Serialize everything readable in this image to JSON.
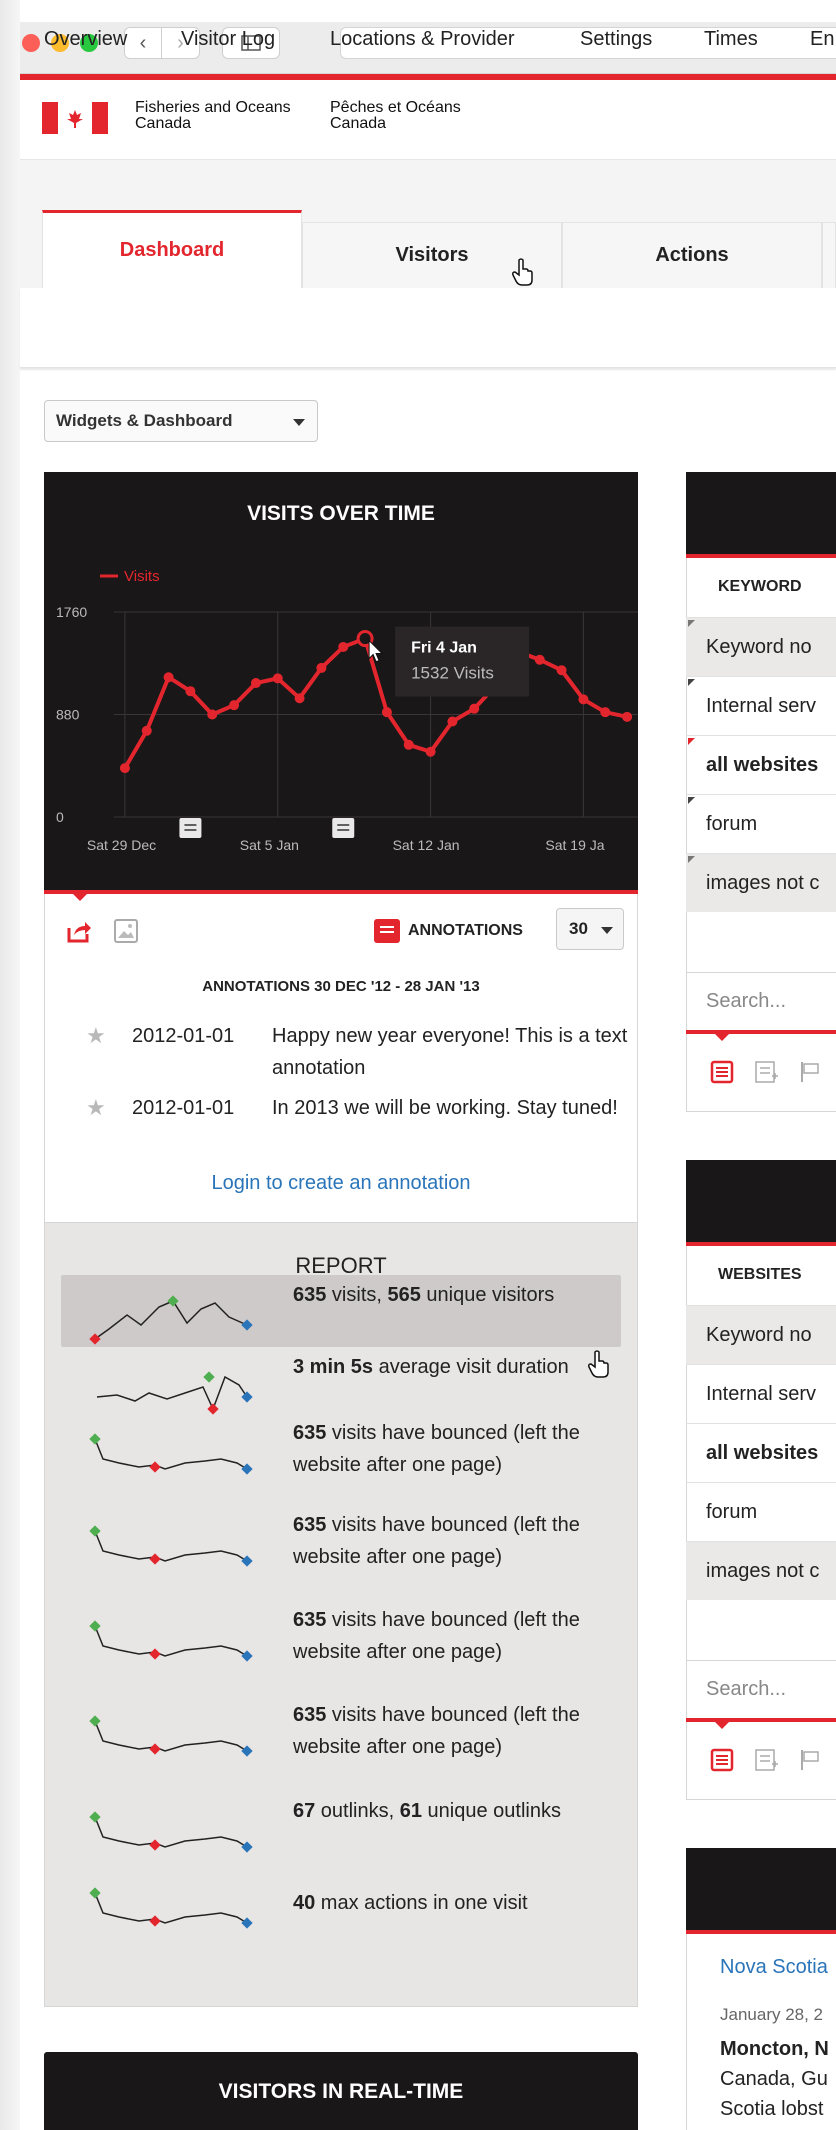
{
  "header": {
    "dept_en": "Fisheries and Oceans Canada",
    "dept_fr": "Pêches et Océans Canada"
  },
  "tabs": [
    {
      "label": "Dashboard",
      "active": true
    },
    {
      "label": "Visitors",
      "active": false
    },
    {
      "label": "Actions",
      "active": false
    }
  ],
  "subnav": [
    "Overview",
    "Visitor Log",
    "Locations & Provider",
    "Settings",
    "Times",
    "En"
  ],
  "widgets_dropdown": "Widgets & Dashboard",
  "visits_chart": {
    "title": "VISITS OVER TIME",
    "tooltip_date": "Fri 4 Jan",
    "tooltip_value": "1532 Visits",
    "annotations_label": "ANNOTATIONS",
    "period_value": "30",
    "chart_data": {
      "type": "line",
      "legend": "Visits",
      "color": "#e3262e",
      "ylim": [
        0,
        1760
      ],
      "y_ticks": [
        "1760",
        "880",
        "0"
      ],
      "x_tick_labels": [
        "Sat 29 Dec",
        "Sat 5 Jan",
        "Sat 12 Jan",
        "Sat 19 Ja"
      ],
      "x": [
        "2012-12-29",
        "2012-12-30",
        "2012-12-31",
        "2013-01-01",
        "2013-01-02",
        "2013-01-03",
        "2013-01-04",
        "2013-01-05",
        "2013-01-06",
        "2013-01-07",
        "2013-01-08",
        "2013-01-09",
        "2013-01-10",
        "2013-01-11",
        "2013-01-12",
        "2013-01-13",
        "2013-01-14",
        "2013-01-15",
        "2013-01-16",
        "2013-01-17",
        "2013-01-18",
        "2013-01-19",
        "2013-01-20",
        "2013-01-21"
      ],
      "values": [
        420,
        740,
        1200,
        1080,
        880,
        960,
        1150,
        1190,
        1020,
        1280,
        1460,
        1532,
        900,
        620,
        560,
        820,
        930,
        1130,
        1420,
        1350,
        1260,
        1010,
        900,
        860
      ],
      "highlight_index": 11
    }
  },
  "annotations": {
    "heading": "ANNOTATIONS 30 DEC '12 - 28 JAN '13",
    "items": [
      {
        "date": "2012-01-01",
        "text": "Happy new year everyone! This is a text annotation"
      },
      {
        "date": "2012-01-01",
        "text": "In 2013 we will be working. Stay tuned!"
      }
    ],
    "login_link": "Login to create an annotation"
  },
  "report": {
    "title": "REPORT",
    "rows": [
      {
        "bold1": "635",
        "t1": " visits, ",
        "bold2": "565",
        "t2": " unique visitors"
      },
      {
        "bold1": "3 min 5s",
        "t1": " average visit duration",
        "bold2": "",
        "t2": ""
      },
      {
        "bold1": "635",
        "t1": " visits have bounced (left the website after one page)",
        "bold2": "",
        "t2": ""
      },
      {
        "bold1": "635",
        "t1": " visits have bounced (left the website after one page)",
        "bold2": "",
        "t2": ""
      },
      {
        "bold1": "635",
        "t1": " visits have bounced (left the website after one page)",
        "bold2": "",
        "t2": ""
      },
      {
        "bold1": "635",
        "t1": " visits have bounced (left the website after one page)",
        "bold2": "",
        "t2": ""
      },
      {
        "bold1": "67",
        "t1": " outlinks, ",
        "bold2": "61",
        "t2": " unique outlinks"
      },
      {
        "bold1": "40",
        "t1": " max actions in one visit",
        "bold2": "",
        "t2": ""
      }
    ]
  },
  "realtime": {
    "title": "VISITORS IN REAL-TIME"
  },
  "keywords_widget": {
    "column": "KEYWORD",
    "rows": [
      "Keyword no",
      "Internal serv",
      "all websites",
      "forum",
      "images not c"
    ],
    "search_placeholder": "Search..."
  },
  "websites_widget": {
    "column": "WEBSITES",
    "rows": [
      "Keyword no",
      "Internal serv",
      "all websites",
      "forum",
      "images not c"
    ],
    "search_placeholder": "Search..."
  },
  "news_widget": {
    "link": "Nova Scotia",
    "date": "January 28, 2",
    "body_bold": "Moncton, N",
    "body_lines": [
      "Canada, Gu",
      "Scotia lobst"
    ]
  }
}
